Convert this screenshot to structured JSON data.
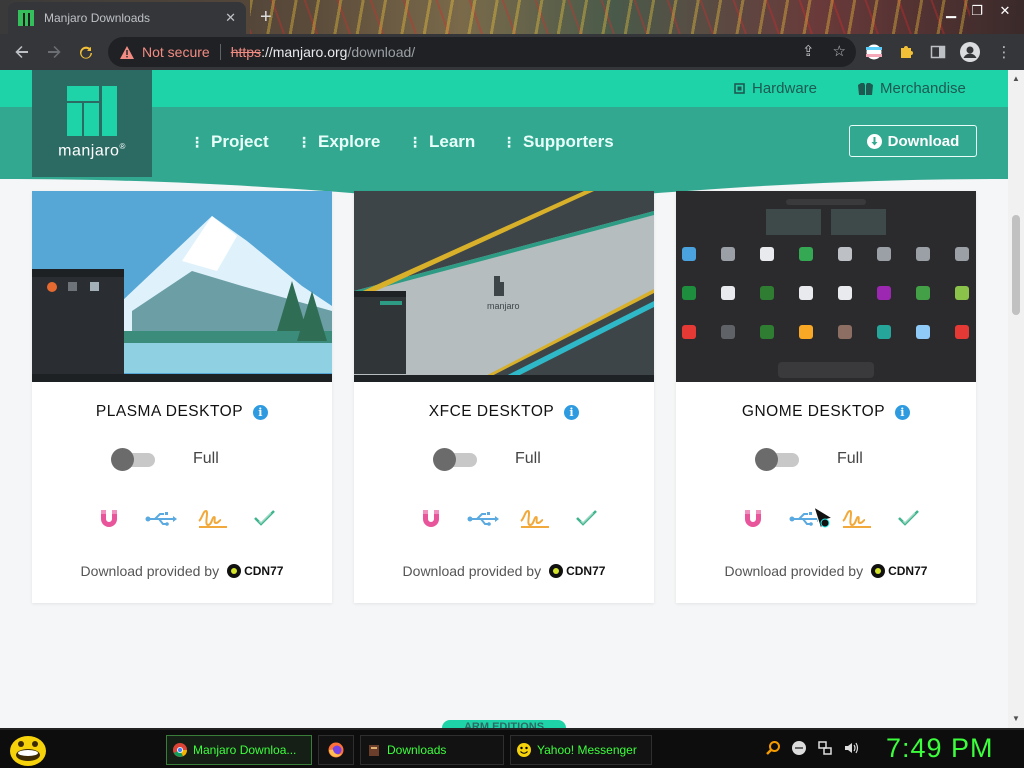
{
  "browser": {
    "tab_title": "Manjaro Downloads",
    "tab_close": "✕",
    "new_tab": "+",
    "security_label": "Not secure",
    "url_scheme": "https",
    "url_host": "://manjaro.org",
    "url_path": "/download/"
  },
  "header": {
    "logo_text": "manjaro",
    "top_links": [
      {
        "label": "Hardware",
        "icon": "chip-icon"
      },
      {
        "label": "Merchandise",
        "icon": "shirts-icon"
      }
    ],
    "nav": [
      {
        "label": "Project"
      },
      {
        "label": "Explore"
      },
      {
        "label": "Learn"
      },
      {
        "label": "Supporters"
      }
    ],
    "download_button": "Download"
  },
  "cards": [
    {
      "title": "PLASMA DESKTOP",
      "toggle_label": "Full",
      "toggle_on": false,
      "provider_text": "Download provided by",
      "provider": "CDN77"
    },
    {
      "title": "XFCE DESKTOP",
      "toggle_label": "Full",
      "toggle_on": false,
      "provider_text": "Download provided by",
      "provider": "CDN77"
    },
    {
      "title": "GNOME DESKTOP",
      "toggle_label": "Full",
      "toggle_on": false,
      "provider_text": "Download provided by",
      "provider": "CDN77"
    }
  ],
  "card_icons": [
    "magnet-icon",
    "usb-icon",
    "signature-icon",
    "checkmark-icon"
  ],
  "arm_label": "ARM EDITIONS",
  "taskbar": {
    "tasks": [
      {
        "label": "Manjaro Downloa...",
        "icon": "chrome-icon"
      },
      {
        "label": "",
        "icon": "firefox-icon"
      },
      {
        "label": "Downloads",
        "icon": "folder-icon"
      },
      {
        "label": "Yahoo! Messenger",
        "icon": "yahoo-icon"
      }
    ],
    "clock": "7:49 PM"
  },
  "colors": {
    "accent": "#1fd3a9",
    "header": "#32a891",
    "logo_bg": "#2c6b64",
    "taskbar_text": "#3cff3c"
  }
}
